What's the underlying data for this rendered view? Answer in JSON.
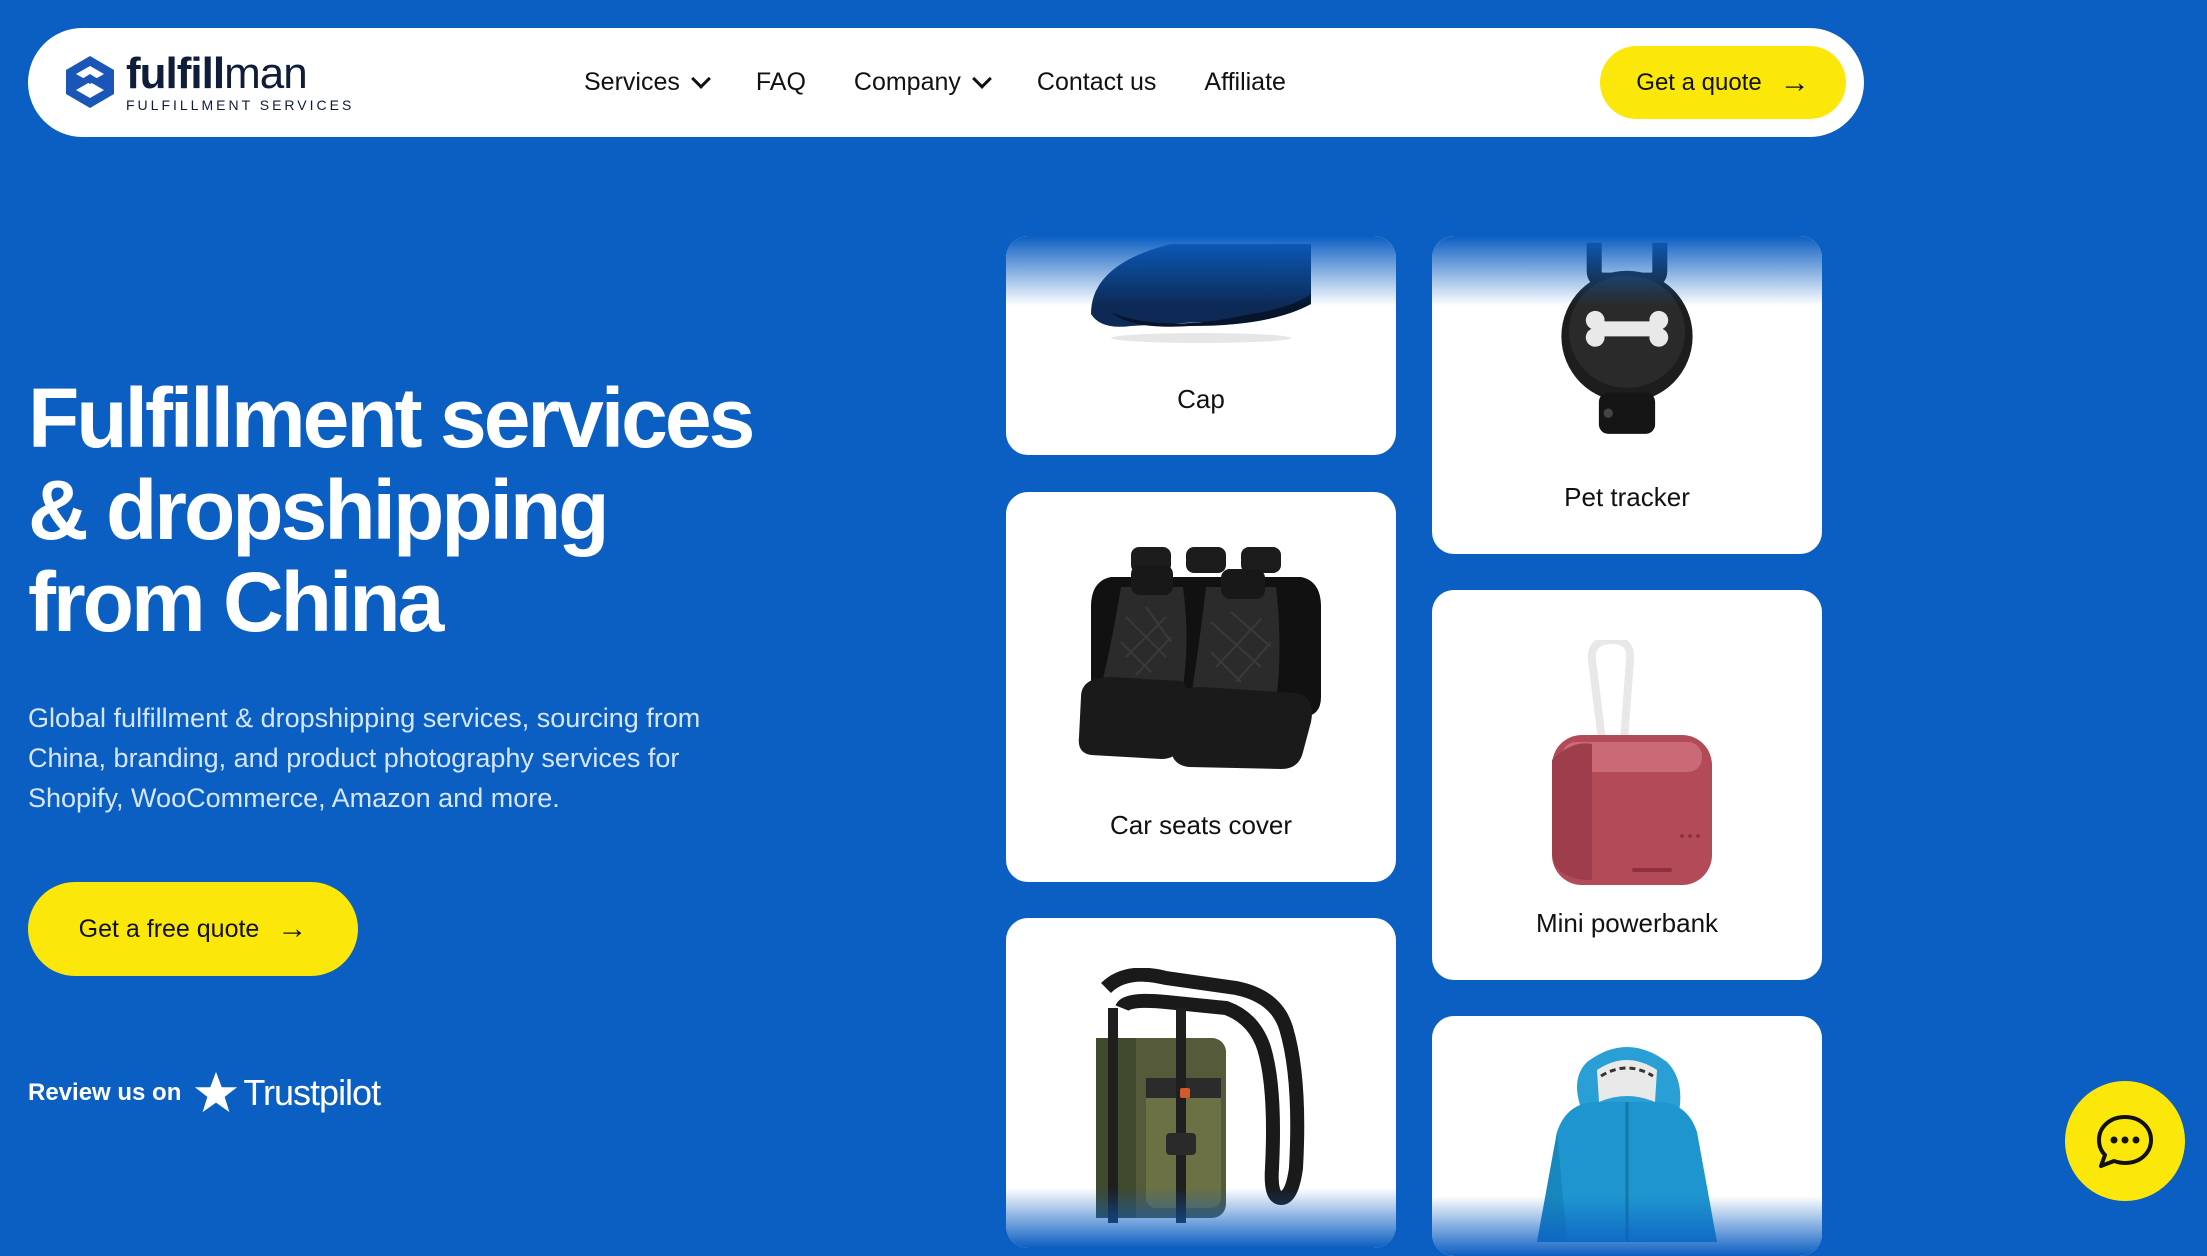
{
  "colors": {
    "background": "#0b5ec2",
    "accent": "#fbe80a",
    "text_dark": "#111111"
  },
  "header": {
    "logo": {
      "word_bold": "fulfill",
      "word_light": "man",
      "subtitle": "FULFILLMENT SERVICES",
      "icon": "fulfillman-logo-icon"
    },
    "nav": [
      {
        "label": "Services",
        "has_dropdown": true
      },
      {
        "label": "FAQ",
        "has_dropdown": false
      },
      {
        "label": "Company",
        "has_dropdown": true
      },
      {
        "label": "Contact us",
        "has_dropdown": false
      },
      {
        "label": "Affiliate",
        "has_dropdown": false
      }
    ],
    "cta_label": "Get a quote"
  },
  "hero": {
    "title_lines": [
      "Fulfillment services",
      "& dropshipping",
      "from China"
    ],
    "description": "Global fulfillment & dropshipping services, sourcing from China, branding, and product photography services for Shopify, WooCommerce, Amazon and more.",
    "cta_label": "Get a free quote"
  },
  "trustpilot": {
    "prefix": "Review us on",
    "brand": "Trustpilot",
    "icon": "star-icon"
  },
  "products": [
    {
      "label": "Cap",
      "icon": "cap-image"
    },
    {
      "label": "Pet tracker",
      "icon": "pet-tracker-image"
    },
    {
      "label": "Car seats cover",
      "icon": "car-seats-image"
    },
    {
      "label": "Mini powerbank",
      "icon": "powerbank-image"
    },
    {
      "label": "",
      "icon": "bag-image"
    },
    {
      "label": "",
      "icon": "raincoat-image"
    }
  ],
  "chat": {
    "icon": "chat-bubble-icon"
  }
}
